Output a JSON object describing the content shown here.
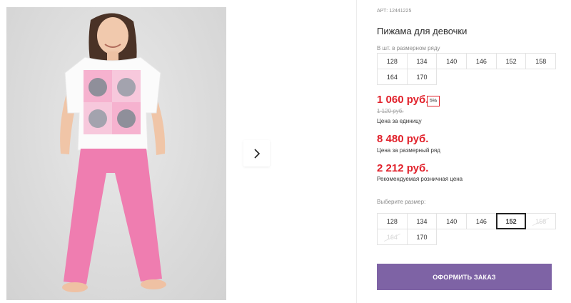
{
  "product": {
    "article": "АРТ: 12441225",
    "title": "Пижама для девочки",
    "sizes_in_row_caption": "В шт. в размерном ряду",
    "sizes_in_row": [
      "128",
      "134",
      "140",
      "146",
      "152",
      "158",
      "164",
      "170"
    ]
  },
  "price": {
    "current": "1 060 руб.",
    "discount": "5%",
    "old": "1 120 руб.",
    "unit_caption": "Цена за единицу",
    "row_total": "8 480 руб.",
    "row_caption": "Цена за размерный ряд",
    "rrp": "2 212 руб.",
    "rrp_caption": "Рекомендуемая розничная цена",
    "accent_color": "#e1212b"
  },
  "size_selector": {
    "caption": "Выберите размер:",
    "options": [
      {
        "label": "128",
        "state": "available"
      },
      {
        "label": "134",
        "state": "available"
      },
      {
        "label": "140",
        "state": "available"
      },
      {
        "label": "146",
        "state": "available"
      },
      {
        "label": "152",
        "state": "selected"
      },
      {
        "label": "158",
        "state": "disabled"
      },
      {
        "label": "164",
        "state": "disabled"
      },
      {
        "label": "170",
        "state": "available"
      }
    ]
  },
  "gallery": {
    "next_icon": "chevron-right-icon"
  },
  "actions": {
    "order_label": "ОФОРМИТЬ ЗАКАЗ",
    "order_color": "#7e63a5"
  }
}
